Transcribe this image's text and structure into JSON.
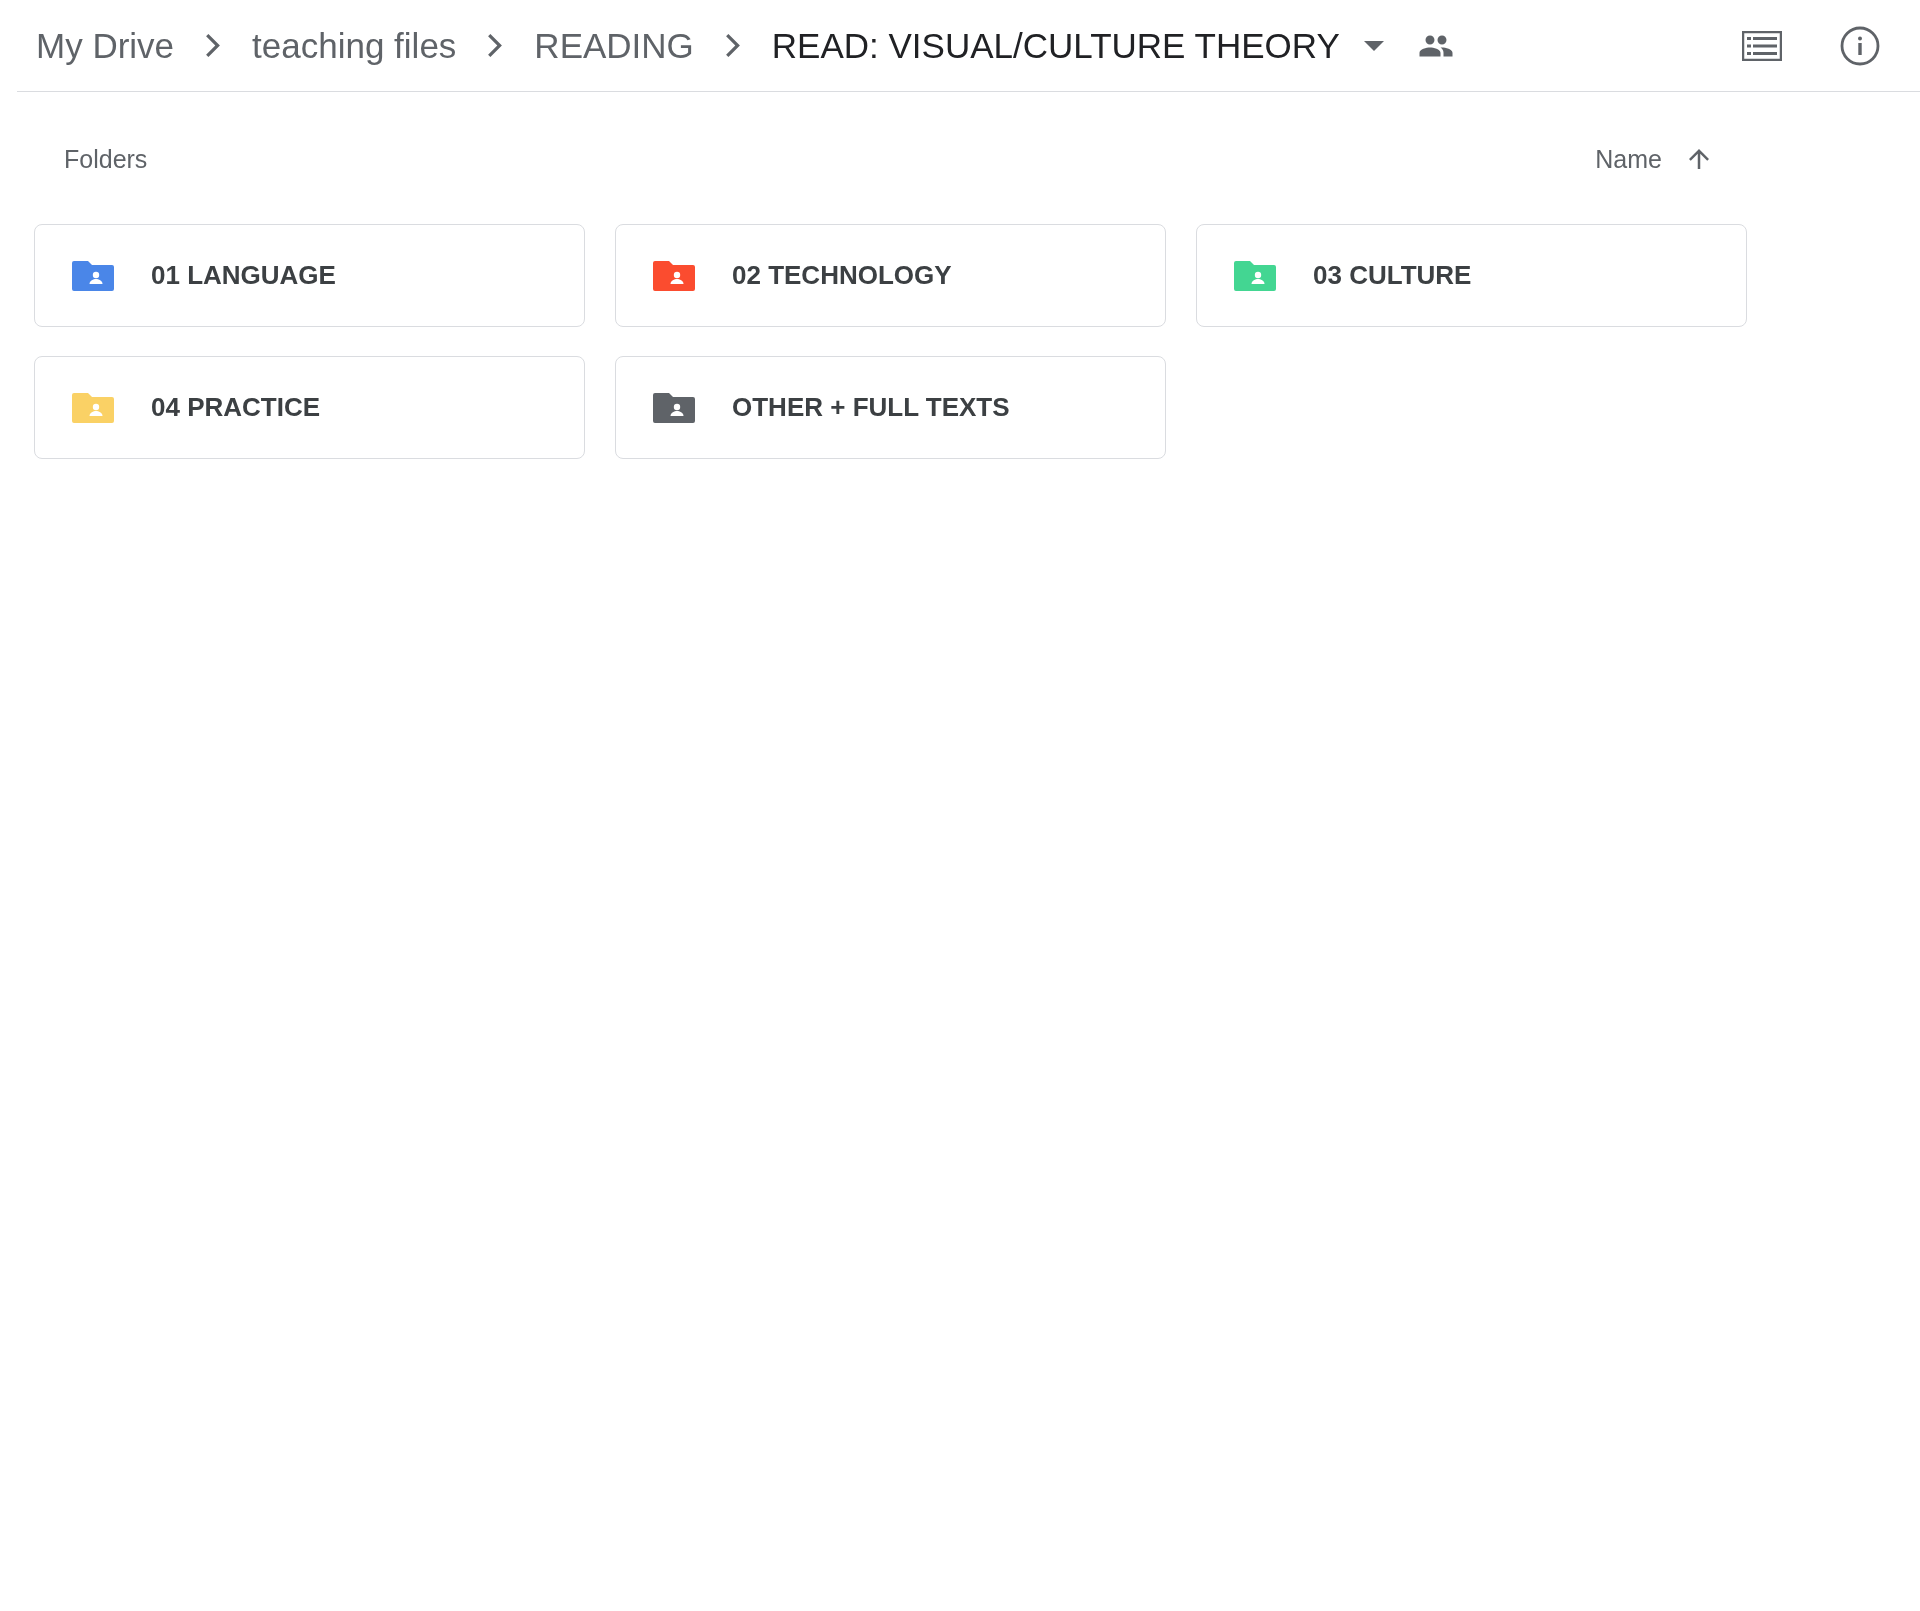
{
  "breadcrumb": [
    {
      "label": "My Drive",
      "current": false
    },
    {
      "label": "teaching files",
      "current": false
    },
    {
      "label": "READING",
      "current": false
    },
    {
      "label": "READ: VISUAL/CULTURE THEORY",
      "current": true
    }
  ],
  "section": {
    "title": "Folders",
    "sort_label": "Name"
  },
  "folders": [
    {
      "name": "01 LANGUAGE",
      "color": "#4a86e8"
    },
    {
      "name": "02 TECHNOLOGY",
      "color": "#fb4c2f"
    },
    {
      "name": "03 CULTURE",
      "color": "#43d692"
    },
    {
      "name": "04 PRACTICE",
      "color": "#fad165"
    },
    {
      "name": "OTHER + FULL TEXTS",
      "color": "#5f6368"
    }
  ]
}
